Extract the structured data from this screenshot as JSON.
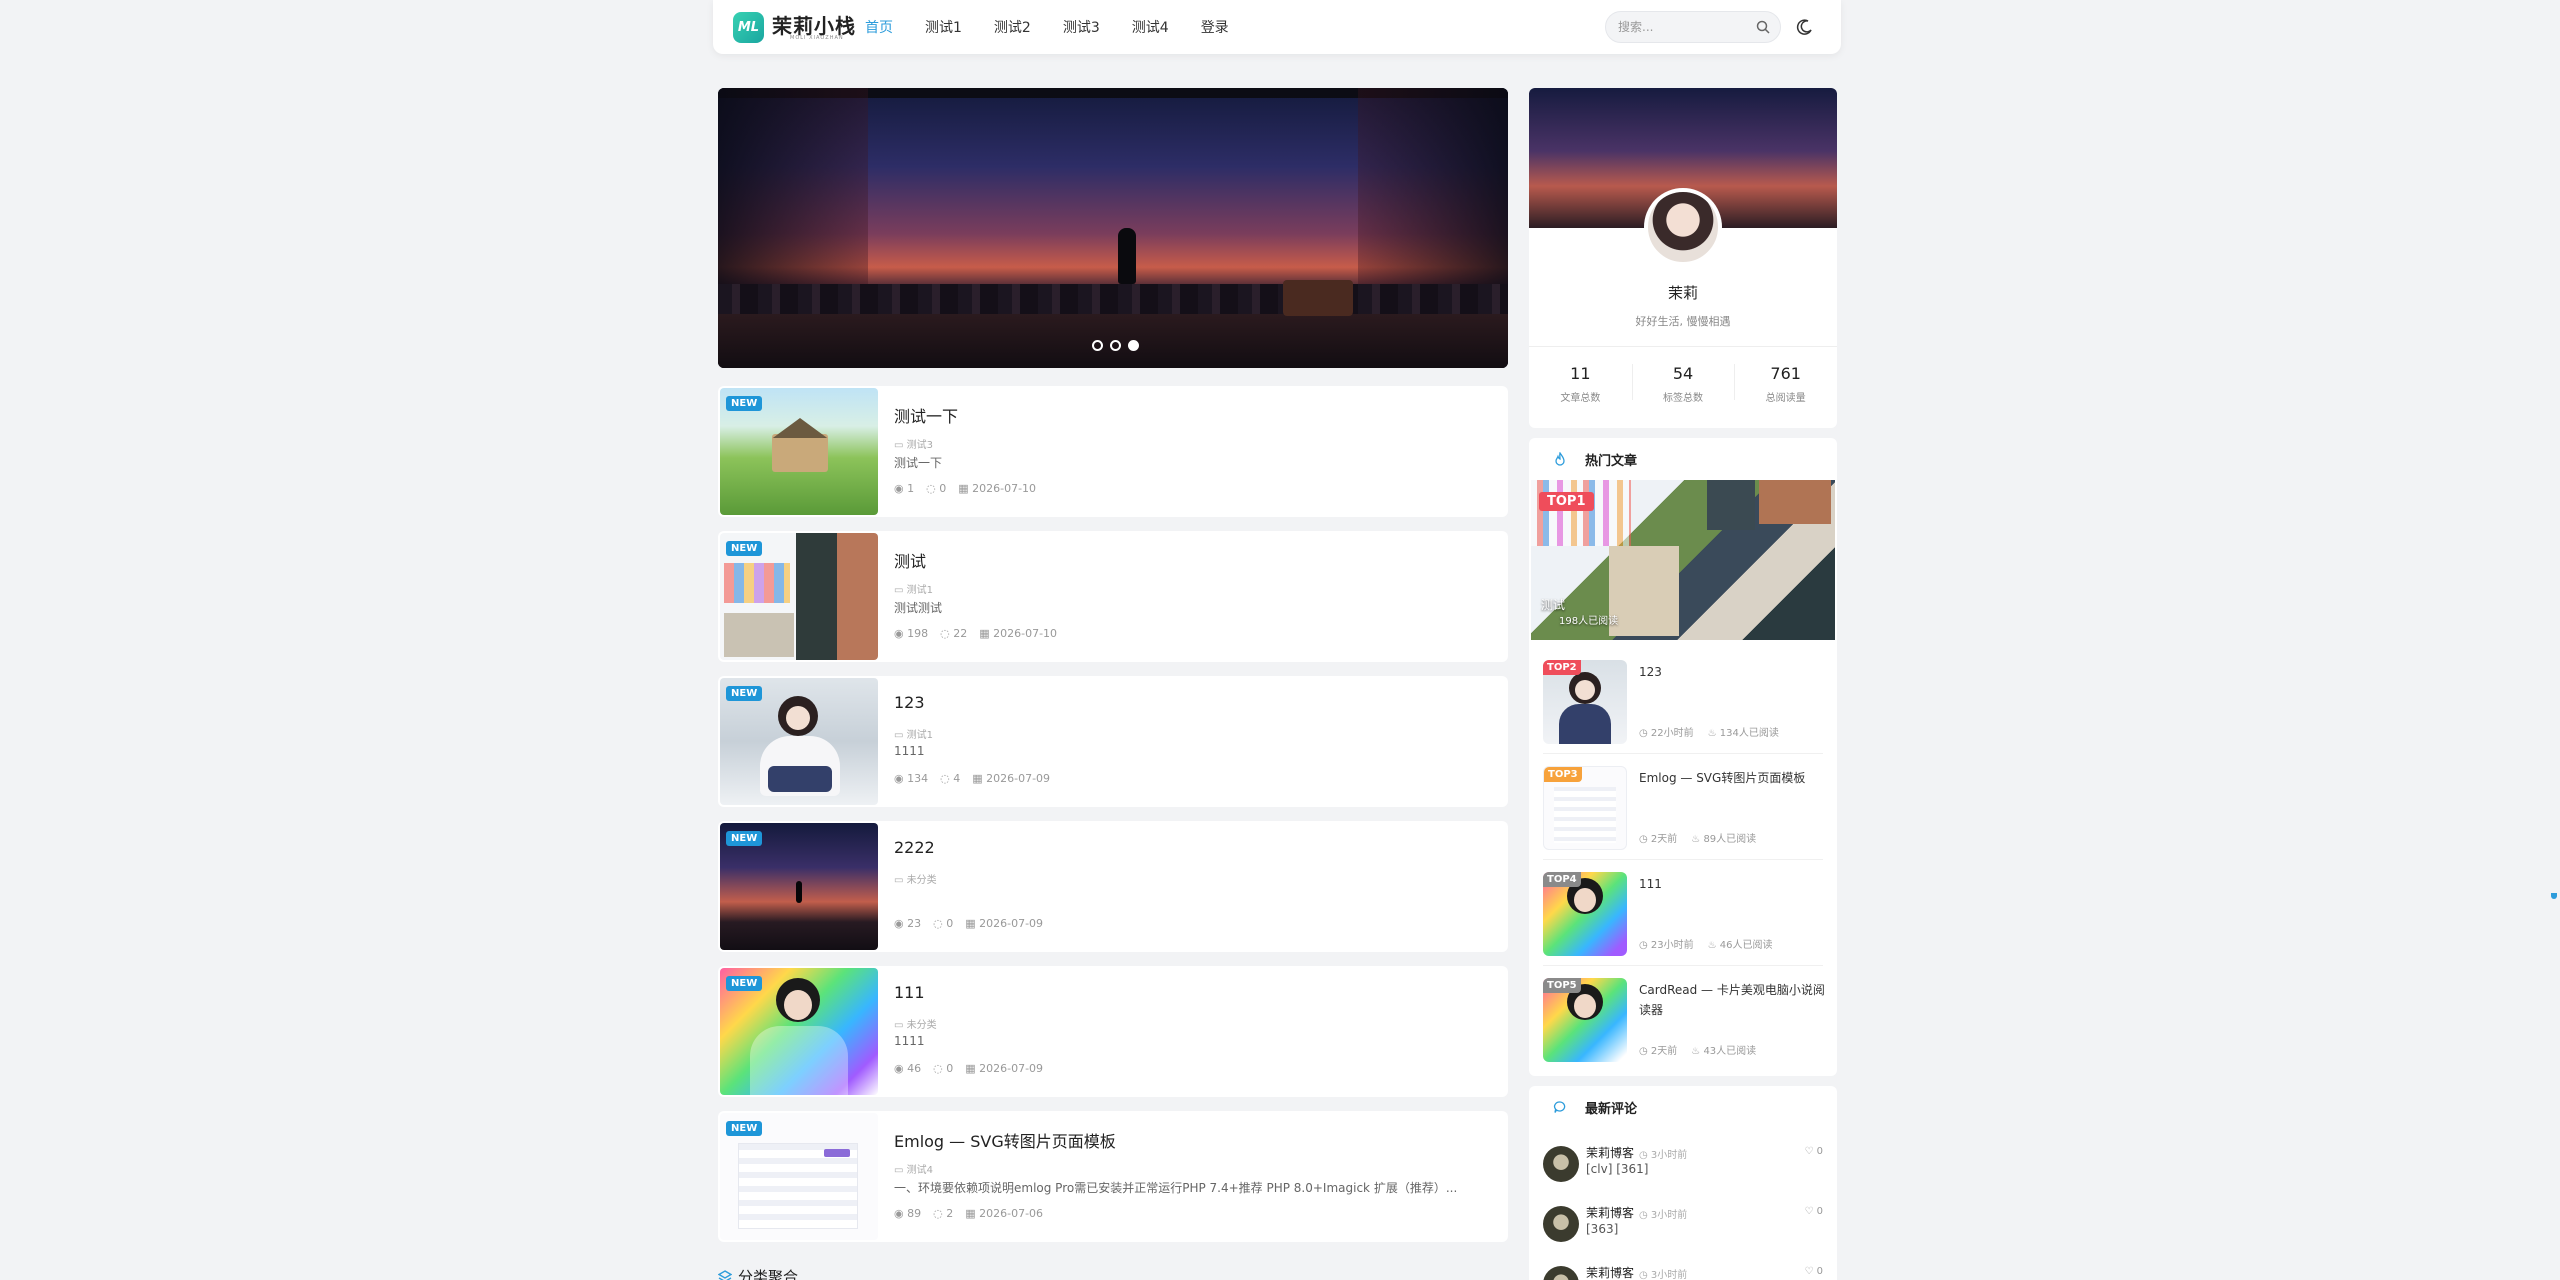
{
  "header": {
    "logo_mark": "ML",
    "logo_text": "茉莉小栈",
    "logo_sub": "MOLI XIAOZHAN",
    "nav": [
      {
        "label": "首页",
        "active": true
      },
      {
        "label": "测试1",
        "active": false
      },
      {
        "label": "测试2",
        "active": false
      },
      {
        "label": "测试3",
        "active": false
      },
      {
        "label": "测试4",
        "active": false
      },
      {
        "label": "登录",
        "active": false
      }
    ],
    "search_placeholder": "搜索...",
    "icons": {
      "search": "search-icon",
      "theme": "moon-icon"
    }
  },
  "banner": {
    "slides": 3,
    "active_slide": 3
  },
  "posts": [
    {
      "title": "测试一下",
      "category": "测试3",
      "excerpt": "测试一下",
      "views": "1",
      "comments": "0",
      "date": "2026-07-10",
      "badge": "NEW"
    },
    {
      "title": "测试",
      "category": "测试1",
      "excerpt": "测试测试",
      "views": "198",
      "comments": "22",
      "date": "2026-07-10",
      "badge": "NEW"
    },
    {
      "title": "123",
      "category": "测试1",
      "excerpt": "1111",
      "views": "134",
      "comments": "4",
      "date": "2026-07-09",
      "badge": "NEW"
    },
    {
      "title": "2222",
      "category": "未分类",
      "excerpt": "",
      "views": "23",
      "comments": "0",
      "date": "2026-07-09",
      "badge": "NEW"
    },
    {
      "title": "111",
      "category": "未分类",
      "excerpt": "1111",
      "views": "46",
      "comments": "0",
      "date": "2026-07-09",
      "badge": "NEW"
    },
    {
      "title": "Emlog — SVG转图片页面模板",
      "category": "测试4",
      "excerpt": "一、环境要依赖项说明emlog Pro需已安装并正常运行PHP 7.4+推荐 PHP 8.0+Imagick 扩展（推荐）...",
      "views": "89",
      "comments": "2",
      "date": "2026-07-06",
      "badge": "NEW"
    }
  ],
  "profile": {
    "name": "茉莉",
    "motto": "好好生活, 慢慢相遇",
    "stats": [
      {
        "value": "11",
        "label": "文章总数"
      },
      {
        "value": "54",
        "label": "标签总数"
      },
      {
        "value": "761",
        "label": "总阅读量"
      }
    ]
  },
  "hot": {
    "title": "热门文章",
    "top1": {
      "badge": "TOP1",
      "title": "测试",
      "reads": "198人已阅读"
    },
    "items": [
      {
        "badge": "TOP2",
        "badge_color": "#ef4d5b",
        "title": "123",
        "time": "22小时前",
        "reads": "134人已阅读"
      },
      {
        "badge": "TOP3",
        "badge_color": "#f7a23b",
        "title": "Emlog — SVG转图片页面模板",
        "time": "2天前",
        "reads": "89人已阅读"
      },
      {
        "badge": "TOP4",
        "badge_color": "#8a8a8a",
        "title": "111",
        "time": "23小时前",
        "reads": "46人已阅读"
      },
      {
        "badge": "TOP5",
        "badge_color": "#8a8a8a",
        "title": "CardRead — 卡片美观电脑小说阅读器",
        "time": "2天前",
        "reads": "43人已阅读"
      }
    ]
  },
  "comments": {
    "title": "最新评论",
    "items": [
      {
        "user": "茉莉博客",
        "time": "3小时前",
        "likes": "0",
        "text": "[clv] [361]"
      },
      {
        "user": "茉莉博客",
        "time": "3小时前",
        "likes": "0",
        "text": "[363]"
      },
      {
        "user": "茉莉博客",
        "time": "3小时前",
        "likes": "0",
        "text": ""
      }
    ]
  },
  "sections": {
    "category_aggregate": "分类聚合"
  },
  "colors": {
    "accent": "#2d9cdb",
    "new_badge": "#1e96d8",
    "top1": "#ef4d5b",
    "background": "#f2f3f5"
  }
}
